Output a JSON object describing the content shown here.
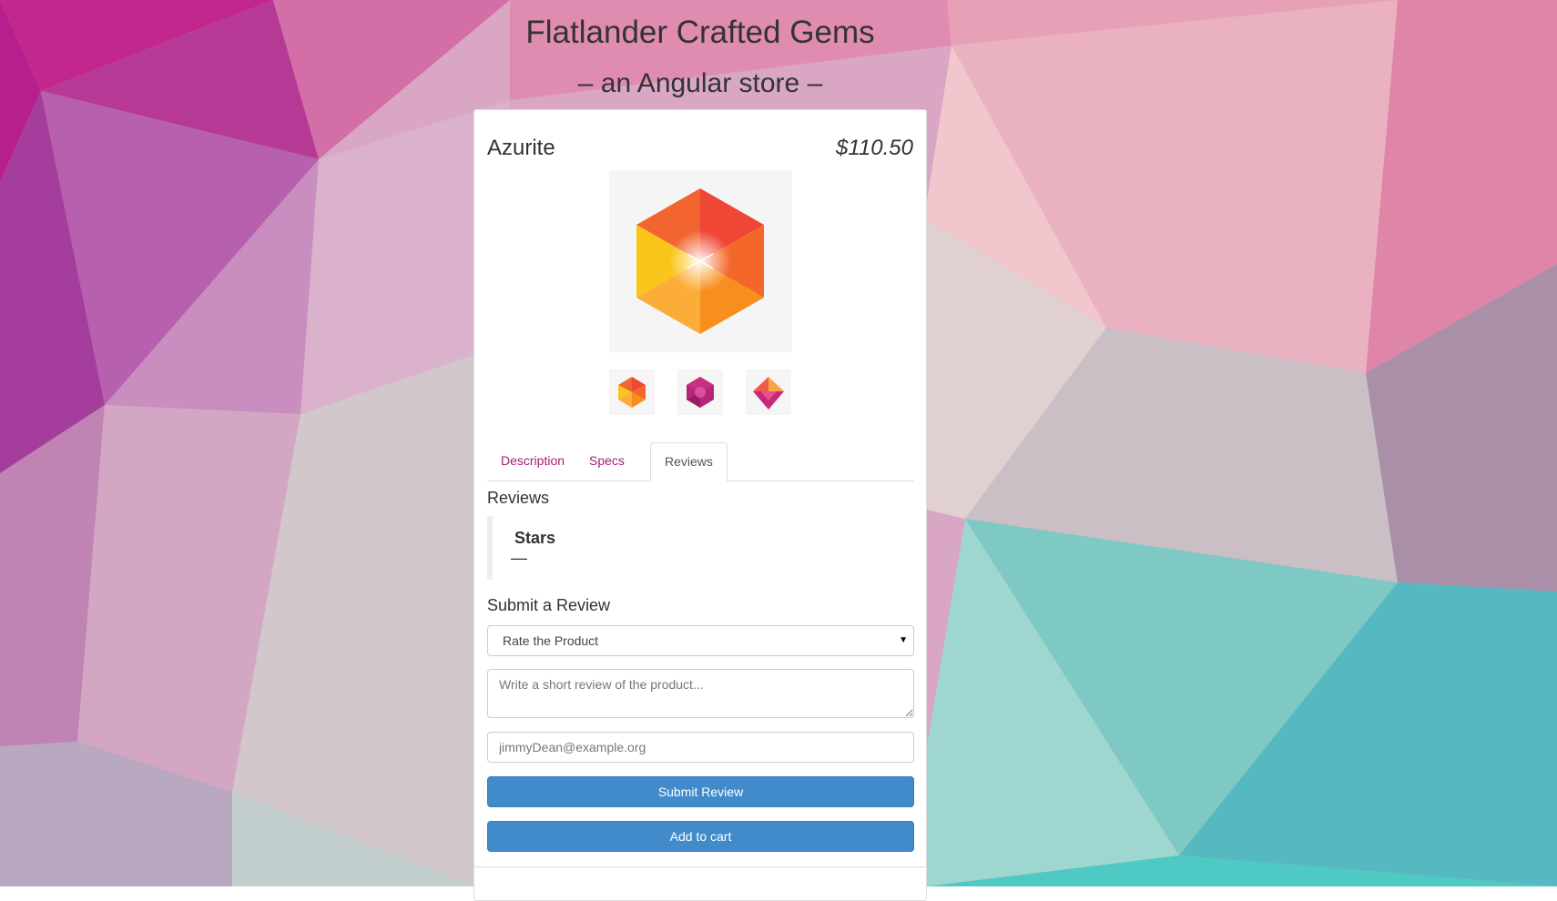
{
  "store": {
    "title": "Flatlander Crafted Gems",
    "subtitle": "– an Angular store –"
  },
  "product": {
    "name": "Azurite",
    "price": "$110.50",
    "main_image_icon": "orange-hexagon-gem-icon",
    "thumbnails": [
      {
        "icon": "orange-hexagon-gem-icon"
      },
      {
        "icon": "magenta-hexagon-gem-icon"
      },
      {
        "icon": "pink-diamond-gem-icon"
      }
    ]
  },
  "tabs": [
    {
      "label": "Description",
      "active": false
    },
    {
      "label": "Specs",
      "active": false
    },
    {
      "label": "Reviews",
      "active": true
    }
  ],
  "reviews": {
    "heading": "Reviews",
    "entry": {
      "stars_label": "Stars",
      "author_line": "—"
    }
  },
  "review_form": {
    "heading": "Submit a Review",
    "rating_select": {
      "selected": "Rate the Product"
    },
    "body_placeholder": "Write a short review of the product...",
    "email_placeholder": "jimmyDean@example.org",
    "submit_label": "Submit Review"
  },
  "cart": {
    "add_label": "Add to cart"
  },
  "colors": {
    "tab_link": "#a31f74",
    "button_primary": "#428bca"
  }
}
